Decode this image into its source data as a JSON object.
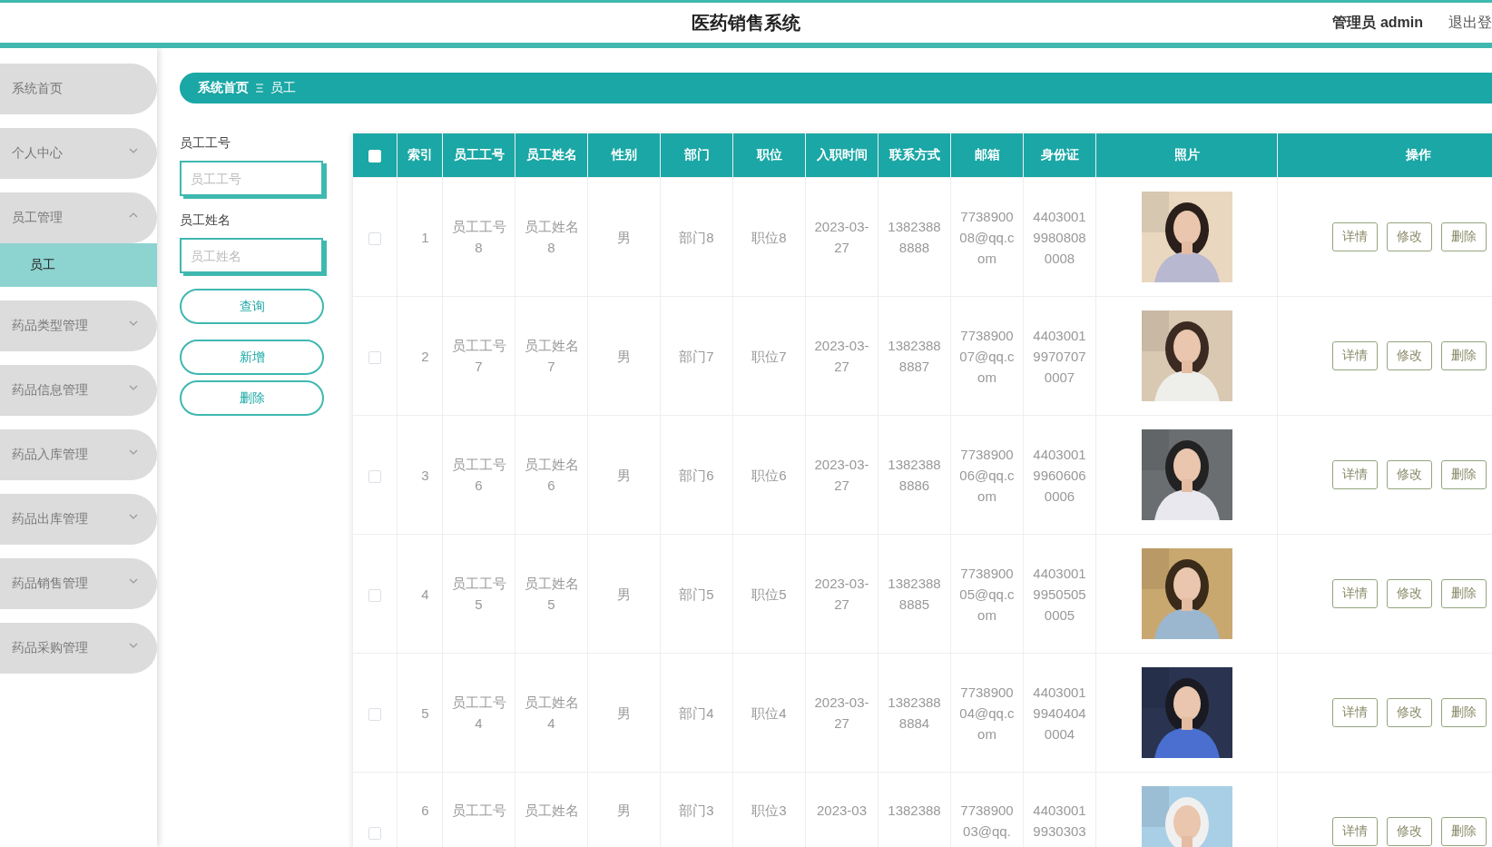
{
  "header": {
    "title": "医药销售系统",
    "user": "管理员 admin",
    "logout": "退出登"
  },
  "sidebar": {
    "items": [
      {
        "label": "系统首页",
        "kind": "link"
      },
      {
        "label": "个人中心",
        "kind": "menu",
        "expanded": false
      },
      {
        "label": "员工管理",
        "kind": "menu",
        "expanded": true,
        "children": [
          {
            "label": "员工",
            "selected": true
          }
        ]
      },
      {
        "label": "药品类型管理",
        "kind": "menu",
        "expanded": false
      },
      {
        "label": "药品信息管理",
        "kind": "menu",
        "expanded": false
      },
      {
        "label": "药品入库管理",
        "kind": "menu",
        "expanded": false
      },
      {
        "label": "药品出库管理",
        "kind": "menu",
        "expanded": false
      },
      {
        "label": "药品销售管理",
        "kind": "menu",
        "expanded": false
      },
      {
        "label": "药品采购管理",
        "kind": "menu",
        "expanded": false
      }
    ]
  },
  "breadcrumb": [
    "系统首页",
    "员工"
  ],
  "filters": [
    {
      "label": "员工工号",
      "placeholder": "员工工号"
    },
    {
      "label": "员工姓名",
      "placeholder": "员工姓名"
    }
  ],
  "filter_buttons": [
    "查询",
    "新增",
    "删除"
  ],
  "table": {
    "select_all_checked": false,
    "columns": [
      "索引",
      "员工工号",
      "员工姓名",
      "性别",
      "部门",
      "职位",
      "入职时间",
      "联系方式",
      "邮箱",
      "身份证",
      "照片",
      "操作"
    ],
    "rows": [
      {
        "checked": false,
        "cells": [
          "1",
          "员工工号8",
          "员工姓名8",
          "男",
          "部门8",
          "职位8",
          "2023-03-27",
          "13823888888",
          "773890008@qq.com",
          "440300199808080008"
        ],
        "actions": [
          "详情",
          "修改",
          "删除"
        ]
      },
      {
        "checked": false,
        "cells": [
          "2",
          "员工工号7",
          "员工姓名7",
          "男",
          "部门7",
          "职位7",
          "2023-03-27",
          "13823888887",
          "773890007@qq.com",
          "440300199707070007"
        ],
        "actions": [
          "详情",
          "修改",
          "删除"
        ]
      },
      {
        "checked": false,
        "cells": [
          "3",
          "员工工号6",
          "员工姓名6",
          "男",
          "部门6",
          "职位6",
          "2023-03-27",
          "13823888886",
          "773890006@qq.com",
          "440300199606060006"
        ],
        "actions": [
          "详情",
          "修改",
          "删除"
        ]
      },
      {
        "checked": false,
        "cells": [
          "4",
          "员工工号5",
          "员工姓名5",
          "男",
          "部门5",
          "职位5",
          "2023-03-27",
          "13823888885",
          "773890005@qq.com",
          "440300199505050005"
        ],
        "actions": [
          "详情",
          "修改",
          "删除"
        ]
      },
      {
        "checked": false,
        "cells": [
          "5",
          "员工工号4",
          "员工姓名4",
          "男",
          "部门4",
          "职位4",
          "2023-03-27",
          "13823888884",
          "773890004@qq.com",
          "440300199404040004"
        ],
        "actions": [
          "详情",
          "修改",
          "删除"
        ]
      },
      {
        "checked": false,
        "cells": [
          "6",
          "员工工号",
          "员工姓名",
          "男",
          "部门3",
          "职位3",
          "2023-03",
          "1382388",
          "773890003@qq.",
          "44030019930303"
        ],
        "actions": [
          "详情",
          "修改",
          "删除"
        ]
      }
    ]
  }
}
